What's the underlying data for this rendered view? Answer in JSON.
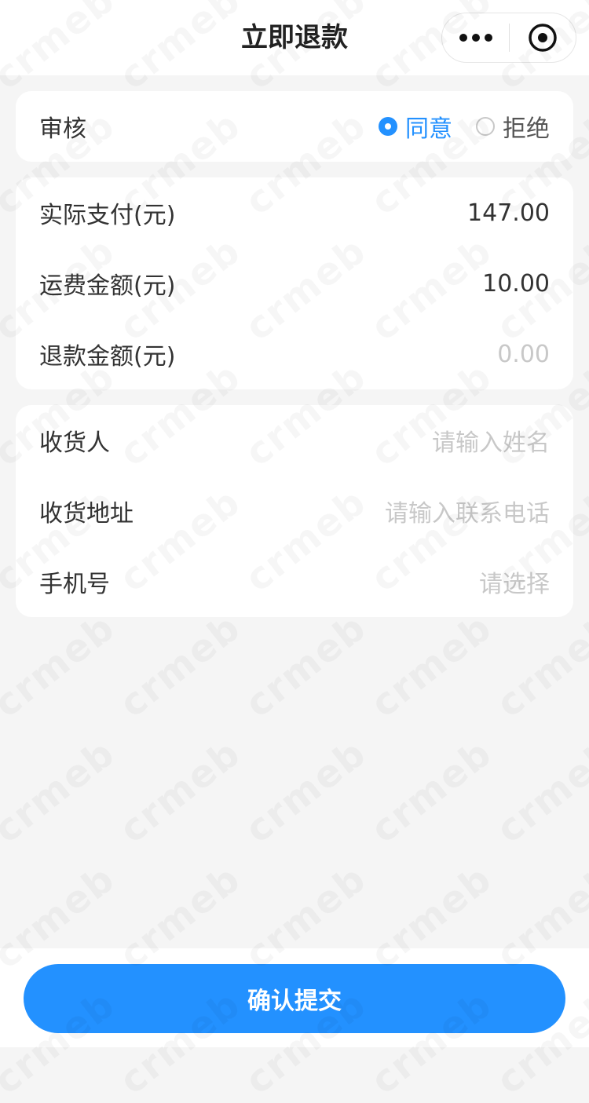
{
  "nav": {
    "title": "立即退款",
    "more_icon": "more-dots-icon",
    "target_icon": "record-target-icon"
  },
  "review": {
    "label": "审核",
    "options": [
      {
        "label": "同意",
        "checked": true
      },
      {
        "label": "拒绝",
        "checked": false
      }
    ]
  },
  "amounts": {
    "actual_paid": {
      "label": "实际支付(元)",
      "value": "147.00"
    },
    "shipping_fee": {
      "label": "运费金额(元)",
      "value": "10.00"
    },
    "refund_amount": {
      "label": "退款金额(元)",
      "placeholder": "0.00"
    }
  },
  "receiver": {
    "consignee": {
      "label": "收货人",
      "placeholder": "请输入姓名"
    },
    "address": {
      "label": "收货地址",
      "placeholder": "请输入联系电话"
    },
    "phone": {
      "label": "手机号",
      "placeholder": "请选择"
    }
  },
  "submit": {
    "label": "确认提交"
  },
  "watermark": "crmeb",
  "colors": {
    "accent": "#2391ff",
    "background": "#f5f5f5"
  }
}
